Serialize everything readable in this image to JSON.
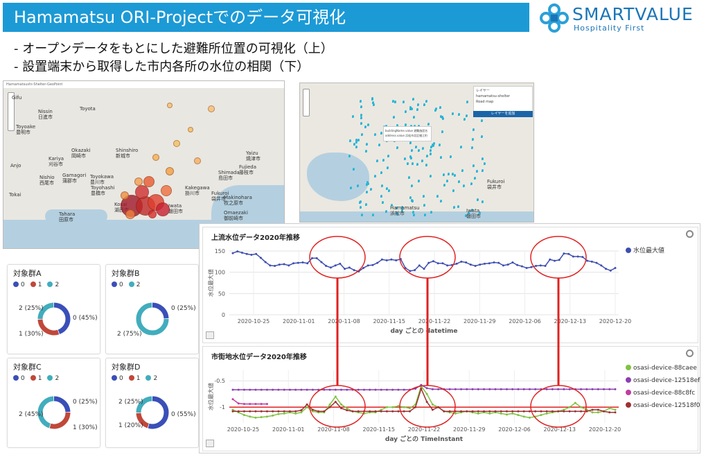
{
  "header": {
    "title": "Hamamatsu ORI-Projectでのデータ可視化",
    "logo_word": "SMARTVALUE",
    "logo_tagline": "Hospitality First"
  },
  "bullets": [
    "- オープンデータをもとにした避難所位置の可視化（上）",
    "- 設置端末から取得した市内各所の水位の相関（下）"
  ],
  "map1": {
    "header": "Hamamatsushi-Shelter-GeoPoint",
    "cities": [
      "Gifu",
      "Toyota",
      "Nissin",
      "日進市",
      "Toyoake",
      "豊明市",
      "Okazaki",
      "岡崎市",
      "Shinshiro",
      "新城市",
      "Kariya",
      "刈谷市",
      "Gamagori",
      "蒲郡市",
      "Toyokawa",
      "豊川市",
      "Toyohashi",
      "豊橋市",
      "Nishio",
      "西尾市",
      "Anjo",
      "Kosai",
      "湖西市",
      "Iwata",
      "磐田市",
      "Fujieda",
      "藤枝市",
      "Shimada",
      "島田市",
      "Kakegawa",
      "掛川市",
      "Makinohara",
      "牧之原市",
      "Omaezaki",
      "御前崎市",
      "Tahara",
      "田原市",
      "Yaizu",
      "焼津市",
      "Fukuroi",
      "袋井市",
      "Tokai"
    ]
  },
  "map2": {
    "layer_title": "レイヤー",
    "layer_items": [
      "hamamatsu-shelter",
      "Road map"
    ],
    "layer_button": "レイヤーを追加",
    "popup_lines": [
      "buildingName.value  避難施設名",
      "address.value  浜松市北区細江町"
    ],
    "cities": [
      "Hamamatsu",
      "浜松市",
      "Fukuroi",
      "袋井市",
      "Iwata",
      "磐田市"
    ]
  },
  "donuts": [
    {
      "title": "対象群A",
      "legend": [
        {
          "label": "0",
          "color": "#3a4fb8"
        },
        {
          "label": "1",
          "color": "#c0483a"
        },
        {
          "label": "2",
          "color": "#41adbd"
        }
      ],
      "slices": [
        0.45,
        0.3,
        0.25
      ],
      "colors": [
        "#3a4fb8",
        "#c0483a",
        "#41adbd"
      ],
      "labels": [
        "0 (45%)",
        "1 (30%)",
        "2 (25%)"
      ]
    },
    {
      "title": "対象群B",
      "legend": [
        {
          "label": "0",
          "color": "#3a4fb8"
        },
        {
          "label": "2",
          "color": "#41adbd"
        }
      ],
      "slices": [
        0.25,
        0.75
      ],
      "colors": [
        "#3a4fb8",
        "#41adbd"
      ],
      "labels": [
        "0 (25%)",
        "2 (75%)"
      ]
    },
    {
      "title": "対象群C",
      "legend": [
        {
          "label": "0",
          "color": "#3a4fb8"
        },
        {
          "label": "1",
          "color": "#c0483a"
        },
        {
          "label": "2",
          "color": "#41adbd"
        }
      ],
      "slices": [
        0.25,
        0.3,
        0.45
      ],
      "colors": [
        "#3a4fb8",
        "#c0483a",
        "#41adbd"
      ],
      "labels": [
        "0 (25%)",
        "1 (30%)",
        "2 (45%)"
      ]
    },
    {
      "title": "対象群D",
      "legend": [
        {
          "label": "0",
          "color": "#3a4fb8"
        },
        {
          "label": "1",
          "color": "#c0483a"
        },
        {
          "label": "2",
          "color": "#41adbd"
        }
      ],
      "slices": [
        0.55,
        0.2,
        0.25
      ],
      "colors": [
        "#3a4fb8",
        "#c0483a",
        "#41adbd"
      ],
      "labels": [
        "0 (55%)",
        "1 (20%)",
        "2 (25%)"
      ]
    }
  ],
  "chart_data": [
    {
      "type": "line",
      "title": "上流水位データ2020年推移",
      "xlabel": "day ごとの datetime",
      "ylabel": "水位最大値",
      "x_ticks": [
        "2020-10-25",
        "2020-11-01",
        "2020-11-08",
        "2020-11-15",
        "2020-11-22",
        "2020-11-29",
        "2020-12-06",
        "2020-12-13",
        "2020-12-20"
      ],
      "ylim": [
        0,
        150
      ],
      "y_ticks": [
        0,
        50,
        100,
        150
      ],
      "series": [
        {
          "name": "水位最大値",
          "color": "#3e4eb0",
          "values": [
            145,
            149,
            146,
            143,
            141,
            143,
            134,
            124,
            116,
            115,
            118,
            119,
            116,
            121,
            122,
            123,
            121,
            133,
            133,
            124,
            115,
            111,
            116,
            120,
            108,
            111,
            105,
            102,
            110,
            116,
            117,
            122,
            130,
            128,
            130,
            128,
            131,
            110,
            103,
            105,
            116,
            108,
            122,
            126,
            121,
            121,
            116,
            117,
            120,
            125,
            123,
            118,
            115,
            118,
            120,
            121,
            123,
            122,
            116,
            118,
            123,
            117,
            114,
            110,
            112,
            115,
            116,
            115,
            130,
            127,
            129,
            144,
            143,
            137,
            137,
            136,
            127,
            125,
            122,
            116,
            108,
            104,
            110
          ]
        }
      ]
    },
    {
      "type": "line",
      "title": "市街地水位データ2020年推移",
      "xlabel": "day ごとの TimeInstant",
      "ylabel": "水位最大値",
      "x_ticks": [
        "2020-10-25",
        "2020-11-01",
        "2020-11-08",
        "2020-11-15",
        "2020-11-22",
        "2020-11-29",
        "2020-12-06",
        "2020-12-13",
        "2020-12-20"
      ],
      "ylim": [
        -1.3,
        -0.3
      ],
      "y_ticks": [
        -1,
        -0.5
      ],
      "reference_line": -1.0,
      "series": [
        {
          "name": "osasi-device-88caee",
          "color": "#7fc242",
          "values": [
            -1.05,
            -1.1,
            -1.15,
            -1.18,
            -1.2,
            -1.19,
            -1.18,
            -1.16,
            -1.13,
            -1.12,
            -1.1,
            -1.12,
            -1.1,
            -1.0,
            -1.08,
            -1.1,
            -1.1,
            -0.95,
            -0.8,
            -0.95,
            -1.02,
            -1.08,
            -1.1,
            -1.12,
            -1.1,
            -1.1,
            -1.05,
            -1.0,
            -1.0,
            -0.98,
            -1.0,
            -1.02,
            -0.95,
            -0.6,
            -0.75,
            -0.95,
            -1.0,
            -1.08,
            -1.1,
            -1.12,
            -1.1,
            -1.08,
            -1.1,
            -1.12,
            -1.1,
            -1.12,
            -1.1,
            -1.12,
            -1.14,
            -1.12,
            -1.15,
            -1.18,
            -1.2,
            -1.18,
            -1.15,
            -1.12,
            -1.1,
            -1.08,
            -1.05,
            -1.0,
            -0.92,
            -1.0,
            -1.05,
            -1.1,
            -1.1,
            -1.08,
            -1.02,
            -1.05
          ]
        },
        {
          "name": "osasi-device-12518ef",
          "color": "#8b3fb0",
          "values": [
            -0.67,
            -0.67,
            -0.67,
            -0.67,
            -0.67,
            -0.67,
            -0.67,
            -0.67,
            -0.67,
            -0.67,
            -0.67,
            -0.67,
            -0.67,
            -0.67,
            -0.67,
            -0.67,
            -0.67,
            -0.67,
            -0.67,
            -0.67,
            -0.67,
            -0.67,
            -0.67,
            -0.67,
            -0.67,
            -0.67,
            -0.67,
            -0.67,
            -0.67,
            -0.67,
            -0.67,
            -0.67,
            -0.65,
            -0.58,
            -0.64,
            -0.66,
            -0.66,
            -0.66,
            -0.66,
            -0.66,
            -0.66,
            -0.66,
            -0.66,
            -0.66,
            -0.66,
            -0.66,
            -0.66,
            -0.66,
            -0.66,
            -0.66,
            -0.66,
            -0.66,
            -0.66,
            -0.66,
            -0.66,
            -0.66,
            -0.66,
            -0.66,
            -0.66,
            -0.66,
            -0.66,
            -0.66,
            -0.66,
            -0.66,
            -0.66,
            -0.66,
            -0.66,
            -0.66
          ]
        },
        {
          "name": "osasi-device-88c8fc",
          "color": "#c03ca0",
          "values": [
            -0.85,
            -0.93,
            -0.94,
            -0.94,
            -0.94,
            -0.94,
            -0.94
          ]
        },
        {
          "name": "osasi-device-12518f0",
          "color": "#9e3132",
          "values": [
            -1.08,
            -1.08,
            -1.08,
            -1.08,
            -1.08,
            -1.08,
            -1.08,
            -1.08,
            -1.08,
            -1.08,
            -1.08,
            -1.08,
            -1.06,
            -0.95,
            -1.05,
            -1.08,
            -1.08,
            -1.0,
            -0.9,
            -1.02,
            -1.06,
            -1.08,
            -1.08,
            -1.08,
            -1.08,
            -1.08,
            -1.08,
            -1.08,
            -1.08,
            -1.08,
            -1.08,
            -1.08,
            -1.0,
            -0.65,
            -0.9,
            -1.05,
            -1.0,
            -1.08,
            -1.08,
            -1.08,
            -1.08,
            -1.08,
            -1.08,
            -1.08,
            -1.08,
            -1.08,
            -1.08,
            -1.08,
            -1.08,
            -1.08,
            -1.08,
            -1.08,
            -1.08,
            -1.08,
            -1.08,
            -1.08,
            -1.08,
            -1.08,
            -1.08,
            -1.08,
            -1.08,
            -1.08,
            -1.08,
            -1.05,
            -1.05,
            -1.08,
            -1.1,
            -1.1
          ]
        }
      ]
    }
  ]
}
